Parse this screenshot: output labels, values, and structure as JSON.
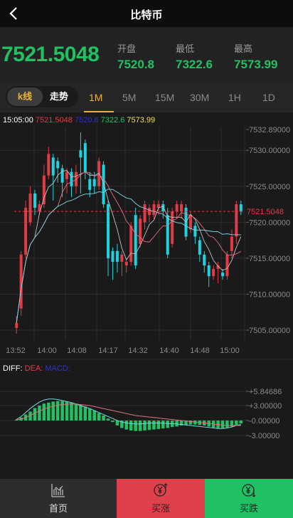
{
  "header": {
    "title": "比特币"
  },
  "price": {
    "current": "7521.5048",
    "open_label": "开盘",
    "open_value": "7520.8",
    "low_label": "最低",
    "low_value": "7322.6",
    "high_label": "最高",
    "high_value": "7573.99"
  },
  "tabs": {
    "kline": "k线",
    "trend": "走势",
    "timeframes": [
      "1M",
      "5M",
      "15M",
      "30M",
      "1H",
      "1D"
    ],
    "active_timeframe": "1M"
  },
  "legend": {
    "time": "15:05:00",
    "close": "7521.5048",
    "open": "7520.8",
    "low": "7322.6",
    "high": "7573.99"
  },
  "macd_legend": {
    "diff": "DIFF:",
    "dea": "DEA:",
    "macd": "MACD:"
  },
  "chart_data": {
    "type": "candlestick",
    "price_axis_labels": [
      "7532.89000",
      "7530.00000",
      "7525.00000",
      "7520.00000",
      "7515.00000",
      "7510.00000",
      "7505.00000"
    ],
    "current_price_label": "7521.5048",
    "time_axis_labels": [
      "13:52",
      "14:00",
      "14:08",
      "14:17",
      "14:32",
      "14:40",
      "14:48",
      "15:00"
    ],
    "macd_axis_labels": [
      "+5.84686",
      "+3.00000",
      "-0.00000",
      "-3.00000"
    ],
    "candles": [
      {
        "o": 7505.3,
        "c": 7506.0,
        "h": 7507.0,
        "l": 7504.5
      },
      {
        "o": 7508.0,
        "c": 7515.5,
        "h": 7516.0,
        "l": 7507.0
      },
      {
        "o": 7515.5,
        "c": 7522.0,
        "h": 7523.0,
        "l": 7515.0
      },
      {
        "o": 7520.0,
        "c": 7524.0,
        "h": 7525.0,
        "l": 7519.5
      },
      {
        "o": 7524.0,
        "c": 7522.0,
        "h": 7524.5,
        "l": 7521.0
      },
      {
        "o": 7521.5,
        "c": 7522.5,
        "h": 7523.0,
        "l": 7521.0
      },
      {
        "o": 7522.5,
        "c": 7526.5,
        "h": 7528.0,
        "l": 7522.0
      },
      {
        "o": 7526.5,
        "c": 7529.5,
        "h": 7530.5,
        "l": 7526.0
      },
      {
        "o": 7529.0,
        "c": 7526.5,
        "h": 7529.5,
        "l": 7523.0
      },
      {
        "o": 7528.5,
        "c": 7527.5,
        "h": 7529.0,
        "l": 7525.5
      },
      {
        "o": 7527.5,
        "c": 7525.5,
        "h": 7528.0,
        "l": 7523.5
      },
      {
        "o": 7526.0,
        "c": 7527.0,
        "h": 7527.5,
        "l": 7524.0
      },
      {
        "o": 7527.0,
        "c": 7525.0,
        "h": 7527.5,
        "l": 7523.5
      },
      {
        "o": 7525.0,
        "c": 7527.0,
        "h": 7528.0,
        "l": 7524.0
      },
      {
        "o": 7530.0,
        "c": 7529.0,
        "h": 7532.5,
        "l": 7524.0
      },
      {
        "o": 7531.0,
        "c": 7527.0,
        "h": 7531.5,
        "l": 7526.0
      },
      {
        "o": 7526.0,
        "c": 7524.5,
        "h": 7527.0,
        "l": 7523.5
      },
      {
        "o": 7526.0,
        "c": 7525.0,
        "h": 7527.0,
        "l": 7524.0
      },
      {
        "o": 7525.0,
        "c": 7528.5,
        "h": 7529.0,
        "l": 7524.5
      },
      {
        "o": 7528.0,
        "c": 7522.5,
        "h": 7528.5,
        "l": 7522.0
      },
      {
        "o": 7522.5,
        "c": 7515.0,
        "h": 7523.0,
        "l": 7512.5
      },
      {
        "o": 7516.0,
        "c": 7514.5,
        "h": 7516.5,
        "l": 7512.0
      },
      {
        "o": 7516.0,
        "c": 7514.5,
        "h": 7517.0,
        "l": 7513.0
      },
      {
        "o": 7514.5,
        "c": 7515.5,
        "h": 7516.0,
        "l": 7512.5
      },
      {
        "o": 7514.0,
        "c": 7514.5,
        "h": 7515.0,
        "l": 7513.0
      },
      {
        "o": 7514.5,
        "c": 7519.5,
        "h": 7520.0,
        "l": 7514.0
      },
      {
        "o": 7521.0,
        "c": 7514.0,
        "h": 7522.0,
        "l": 7513.5
      },
      {
        "o": 7517.0,
        "c": 7520.5,
        "h": 7521.0,
        "l": 7516.5
      },
      {
        "o": 7520.0,
        "c": 7522.5,
        "h": 7523.0,
        "l": 7519.0
      },
      {
        "o": 7521.0,
        "c": 7522.0,
        "h": 7522.5,
        "l": 7520.0
      },
      {
        "o": 7521.0,
        "c": 7522.5,
        "h": 7523.0,
        "l": 7520.5
      },
      {
        "o": 7522.0,
        "c": 7522.5,
        "h": 7523.0,
        "l": 7521.0
      },
      {
        "o": 7522.5,
        "c": 7521.5,
        "h": 7523.0,
        "l": 7520.5
      },
      {
        "o": 7521.0,
        "c": 7515.5,
        "h": 7522.0,
        "l": 7515.0
      },
      {
        "o": 7517.0,
        "c": 7521.5,
        "h": 7522.0,
        "l": 7516.5
      },
      {
        "o": 7521.5,
        "c": 7522.5,
        "h": 7523.0,
        "l": 7520.5
      },
      {
        "o": 7521.5,
        "c": 7522.5,
        "h": 7523.0,
        "l": 7520.5
      },
      {
        "o": 7522.0,
        "c": 7518.0,
        "h": 7522.5,
        "l": 7517.5
      },
      {
        "o": 7519.0,
        "c": 7521.0,
        "h": 7521.5,
        "l": 7518.5
      },
      {
        "o": 7519.5,
        "c": 7518.0,
        "h": 7520.0,
        "l": 7517.0
      },
      {
        "o": 7517.5,
        "c": 7515.5,
        "h": 7518.0,
        "l": 7514.5
      },
      {
        "o": 7515.5,
        "c": 7514.0,
        "h": 7516.0,
        "l": 7513.0
      },
      {
        "o": 7514.0,
        "c": 7512.5,
        "h": 7514.5,
        "l": 7511.0
      },
      {
        "o": 7512.5,
        "c": 7513.5,
        "h": 7514.0,
        "l": 7512.0
      },
      {
        "o": 7513.5,
        "c": 7514.0,
        "h": 7514.5,
        "l": 7511.5
      },
      {
        "o": 7513.0,
        "c": 7512.5,
        "h": 7513.5,
        "l": 7512.0
      },
      {
        "o": 7512.5,
        "c": 7515.5,
        "h": 7516.0,
        "l": 7512.0
      },
      {
        "o": 7516.0,
        "c": 7518.0,
        "h": 7519.0,
        "l": 7515.0
      },
      {
        "o": 7518.0,
        "c": 7522.5,
        "h": 7523.0,
        "l": 7517.0
      },
      {
        "o": 7522.5,
        "c": 7521.5,
        "h": 7523.0,
        "l": 7521.0
      }
    ],
    "macd_hist": [
      0.2,
      0.6,
      1.2,
      1.8,
      2.5,
      3.0,
      3.4,
      3.6,
      3.8,
      3.9,
      3.9,
      3.8,
      3.6,
      3.4,
      3.1,
      2.8,
      2.4,
      2.0,
      1.5,
      1.0,
      0.4,
      -0.3,
      -1.0,
      -1.5,
      -1.8,
      -2.0,
      -2.1,
      -2.1,
      -2.0,
      -1.9,
      -1.8,
      -1.7,
      -1.6,
      -1.5,
      -1.3,
      -1.2,
      -1.0,
      -0.9,
      -0.8,
      -0.8,
      -0.9,
      -1.0,
      -1.2,
      -1.4,
      -1.5,
      -1.5,
      -1.4,
      -1.2,
      -0.9,
      -0.6
    ],
    "diff": [
      0.2,
      0.8,
      1.6,
      2.4,
      3.1,
      3.7,
      4.1,
      4.3,
      4.3,
      4.2,
      4.0,
      3.8,
      3.6,
      3.3,
      3.0,
      2.7,
      2.4,
      2.0,
      1.6,
      1.2,
      0.8,
      0.4,
      0.0,
      -0.3,
      -0.5,
      -0.6,
      -0.7,
      -0.7,
      -0.6,
      -0.5,
      -0.5,
      -0.5,
      -0.5,
      -0.6,
      -0.6,
      -0.7,
      -0.8,
      -0.9,
      -1.0,
      -1.1,
      -1.2,
      -1.3,
      -1.4,
      -1.5,
      -1.6,
      -1.6,
      -1.5,
      -1.3,
      -1.0,
      -0.8
    ],
    "dea": [
      0.1,
      0.3,
      0.6,
      1.0,
      1.5,
      1.9,
      2.3,
      2.6,
      2.9,
      3.1,
      3.2,
      3.3,
      3.3,
      3.3,
      3.2,
      3.1,
      3.0,
      2.8,
      2.6,
      2.4,
      2.2,
      2.0,
      1.8,
      1.6,
      1.4,
      1.2,
      1.0,
      0.9,
      0.8,
      0.7,
      0.6,
      0.5,
      0.4,
      0.3,
      0.2,
      0.1,
      0.0,
      -0.1,
      -0.2,
      -0.3,
      -0.4,
      -0.5,
      -0.6,
      -0.7,
      -0.8,
      -0.9,
      -1.0,
      -1.0,
      -1.0,
      -1.0
    ]
  },
  "colors": {
    "up": "#e03c47",
    "down": "#1dd3e0",
    "green": "#21c063",
    "gold": "#e9b33d"
  },
  "footer": {
    "home": "首页",
    "rise": "买涨",
    "fall": "买跌"
  }
}
